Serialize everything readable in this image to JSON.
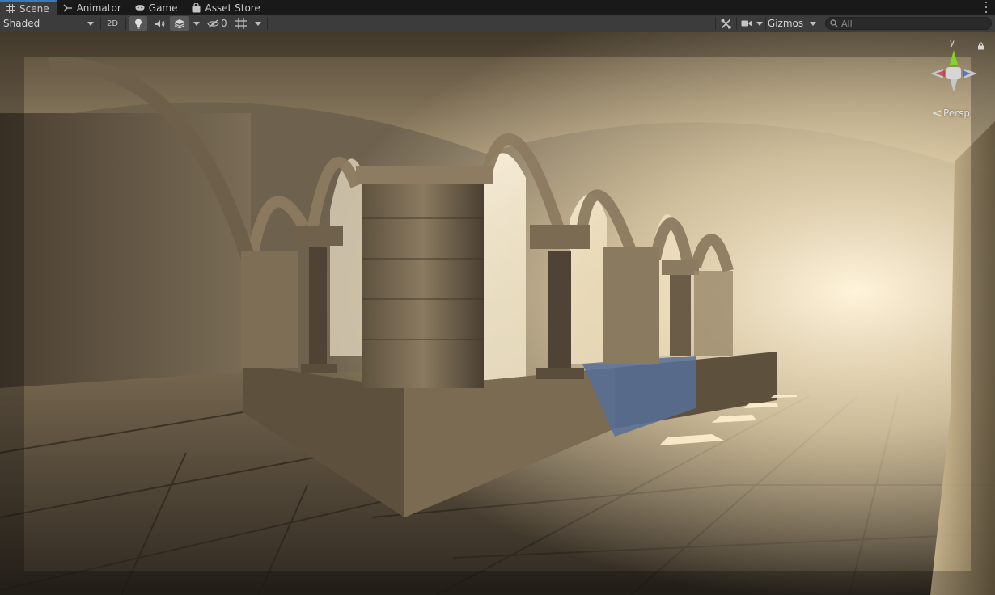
{
  "tabs": [
    {
      "label": "Scene",
      "icon": "grid-icon",
      "active": true
    },
    {
      "label": "Animator",
      "icon": "animator-icon",
      "active": false
    },
    {
      "label": "Game",
      "icon": "gamepad-icon",
      "active": false
    },
    {
      "label": "Asset Store",
      "icon": "shopping-bag-icon",
      "active": false
    }
  ],
  "toolbar": {
    "draw_mode": "Shaded",
    "mode_2d": "2D",
    "hidden_count": "0",
    "gizmos_label": "Gizmos",
    "search_placeholder": "All"
  },
  "gizmo": {
    "axis_label": "y",
    "projection": "Persp"
  },
  "colors": {
    "tab_active_accent": "#3a79bb",
    "toolbar_bg": "#3c3c3c",
    "gizmo_y": "#7fd81f",
    "gizmo_x": "#c23b3b",
    "gizmo_z": "#3a64c4"
  }
}
